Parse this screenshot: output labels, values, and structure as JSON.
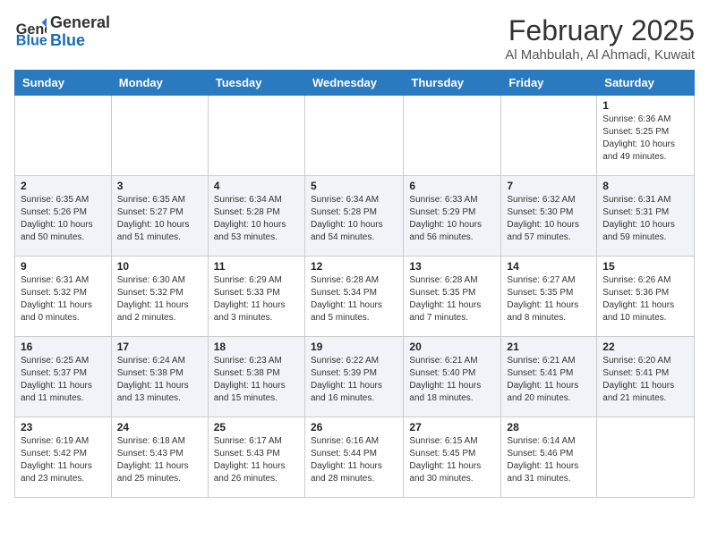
{
  "header": {
    "logo_general": "General",
    "logo_blue": "Blue",
    "month_year": "February 2025",
    "location": "Al Mahbulah, Al Ahmadi, Kuwait"
  },
  "days_of_week": [
    "Sunday",
    "Monday",
    "Tuesday",
    "Wednesday",
    "Thursday",
    "Friday",
    "Saturday"
  ],
  "weeks": [
    [
      {
        "num": "",
        "info": ""
      },
      {
        "num": "",
        "info": ""
      },
      {
        "num": "",
        "info": ""
      },
      {
        "num": "",
        "info": ""
      },
      {
        "num": "",
        "info": ""
      },
      {
        "num": "",
        "info": ""
      },
      {
        "num": "1",
        "info": "Sunrise: 6:36 AM\nSunset: 5:25 PM\nDaylight: 10 hours\nand 49 minutes."
      }
    ],
    [
      {
        "num": "2",
        "info": "Sunrise: 6:35 AM\nSunset: 5:26 PM\nDaylight: 10 hours\nand 50 minutes."
      },
      {
        "num": "3",
        "info": "Sunrise: 6:35 AM\nSunset: 5:27 PM\nDaylight: 10 hours\nand 51 minutes."
      },
      {
        "num": "4",
        "info": "Sunrise: 6:34 AM\nSunset: 5:28 PM\nDaylight: 10 hours\nand 53 minutes."
      },
      {
        "num": "5",
        "info": "Sunrise: 6:34 AM\nSunset: 5:28 PM\nDaylight: 10 hours\nand 54 minutes."
      },
      {
        "num": "6",
        "info": "Sunrise: 6:33 AM\nSunset: 5:29 PM\nDaylight: 10 hours\nand 56 minutes."
      },
      {
        "num": "7",
        "info": "Sunrise: 6:32 AM\nSunset: 5:30 PM\nDaylight: 10 hours\nand 57 minutes."
      },
      {
        "num": "8",
        "info": "Sunrise: 6:31 AM\nSunset: 5:31 PM\nDaylight: 10 hours\nand 59 minutes."
      }
    ],
    [
      {
        "num": "9",
        "info": "Sunrise: 6:31 AM\nSunset: 5:32 PM\nDaylight: 11 hours\nand 0 minutes."
      },
      {
        "num": "10",
        "info": "Sunrise: 6:30 AM\nSunset: 5:32 PM\nDaylight: 11 hours\nand 2 minutes."
      },
      {
        "num": "11",
        "info": "Sunrise: 6:29 AM\nSunset: 5:33 PM\nDaylight: 11 hours\nand 3 minutes."
      },
      {
        "num": "12",
        "info": "Sunrise: 6:28 AM\nSunset: 5:34 PM\nDaylight: 11 hours\nand 5 minutes."
      },
      {
        "num": "13",
        "info": "Sunrise: 6:28 AM\nSunset: 5:35 PM\nDaylight: 11 hours\nand 7 minutes."
      },
      {
        "num": "14",
        "info": "Sunrise: 6:27 AM\nSunset: 5:35 PM\nDaylight: 11 hours\nand 8 minutes."
      },
      {
        "num": "15",
        "info": "Sunrise: 6:26 AM\nSunset: 5:36 PM\nDaylight: 11 hours\nand 10 minutes."
      }
    ],
    [
      {
        "num": "16",
        "info": "Sunrise: 6:25 AM\nSunset: 5:37 PM\nDaylight: 11 hours\nand 11 minutes."
      },
      {
        "num": "17",
        "info": "Sunrise: 6:24 AM\nSunset: 5:38 PM\nDaylight: 11 hours\nand 13 minutes."
      },
      {
        "num": "18",
        "info": "Sunrise: 6:23 AM\nSunset: 5:38 PM\nDaylight: 11 hours\nand 15 minutes."
      },
      {
        "num": "19",
        "info": "Sunrise: 6:22 AM\nSunset: 5:39 PM\nDaylight: 11 hours\nand 16 minutes."
      },
      {
        "num": "20",
        "info": "Sunrise: 6:21 AM\nSunset: 5:40 PM\nDaylight: 11 hours\nand 18 minutes."
      },
      {
        "num": "21",
        "info": "Sunrise: 6:21 AM\nSunset: 5:41 PM\nDaylight: 11 hours\nand 20 minutes."
      },
      {
        "num": "22",
        "info": "Sunrise: 6:20 AM\nSunset: 5:41 PM\nDaylight: 11 hours\nand 21 minutes."
      }
    ],
    [
      {
        "num": "23",
        "info": "Sunrise: 6:19 AM\nSunset: 5:42 PM\nDaylight: 11 hours\nand 23 minutes."
      },
      {
        "num": "24",
        "info": "Sunrise: 6:18 AM\nSunset: 5:43 PM\nDaylight: 11 hours\nand 25 minutes."
      },
      {
        "num": "25",
        "info": "Sunrise: 6:17 AM\nSunset: 5:43 PM\nDaylight: 11 hours\nand 26 minutes."
      },
      {
        "num": "26",
        "info": "Sunrise: 6:16 AM\nSunset: 5:44 PM\nDaylight: 11 hours\nand 28 minutes."
      },
      {
        "num": "27",
        "info": "Sunrise: 6:15 AM\nSunset: 5:45 PM\nDaylight: 11 hours\nand 30 minutes."
      },
      {
        "num": "28",
        "info": "Sunrise: 6:14 AM\nSunset: 5:46 PM\nDaylight: 11 hours\nand 31 minutes."
      },
      {
        "num": "",
        "info": ""
      }
    ]
  ]
}
